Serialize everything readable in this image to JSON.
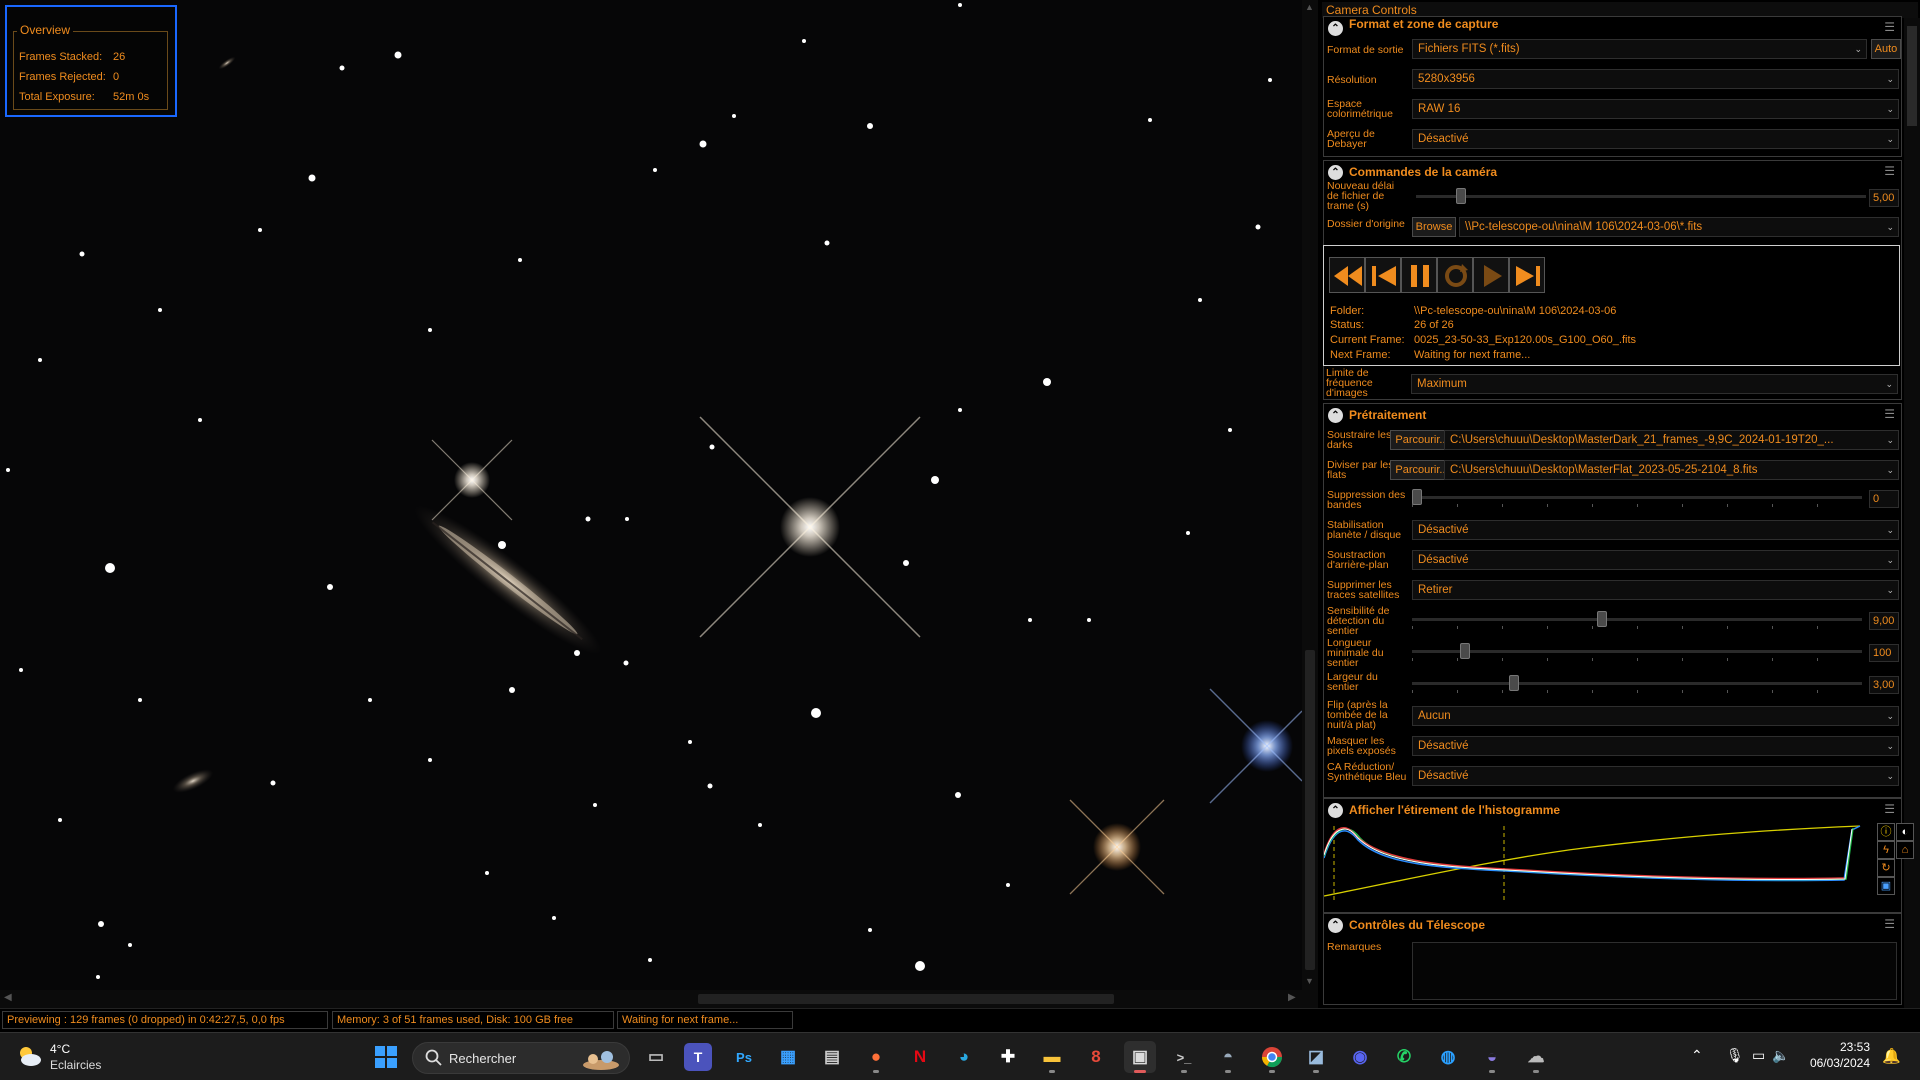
{
  "overview": {
    "legend": "Overview",
    "rows": [
      {
        "label": "Frames Stacked:",
        "value": "26"
      },
      {
        "label": "Frames Rejected:",
        "value": "0"
      },
      {
        "label": "Total Exposure:",
        "value": "52m 0s"
      }
    ]
  },
  "panel": {
    "title": "Camera Controls",
    "format": {
      "heading": "Format et zone de capture",
      "output_label": "Format de sortie",
      "output_value": "Fichiers FITS (*.fits)",
      "auto_button": "Auto",
      "resolution_label": "Résolution",
      "resolution_value": "5280x3956",
      "colorspace_label": "Espace colorimétrique",
      "colorspace_value": "RAW 16",
      "debayer_label": "Aperçu de Debayer",
      "debayer_value": "Désactivé"
    },
    "camera": {
      "heading": "Commandes de la caméra",
      "delay_label": "Nouveau délai de fichier de trame (s)",
      "delay_value": "5,00",
      "delay_level": 0.09,
      "source_label": "Dossier d'origine",
      "browse_button": "Browse",
      "source_value": "\\\\Pc-telescope-ou\\nina\\M 106\\2024-03-06\\*.fits",
      "player_buttons": [
        "rewind-icon",
        "skip-start-icon",
        "pause-icon",
        "refresh-icon",
        "play-icon",
        "skip-end-icon"
      ],
      "info": [
        {
          "label": "Folder:",
          "value": "\\\\Pc-telescope-ou\\nina\\M 106\\2024-03-06"
        },
        {
          "label": "Status:",
          "value": "26 of 26"
        },
        {
          "label": "Current Frame:",
          "value": "0025_23-50-33_Exp120.00s_G100_O60_.fits"
        },
        {
          "label": "Next Frame:",
          "value": "Waiting for next frame..."
        }
      ],
      "framerate_label": "Limite de fréquence d'images",
      "framerate_value": "Maximum"
    },
    "preprocessing": {
      "heading": "Prétraitement",
      "darks_label": "Soustraire les darks",
      "darks_button": "Parcourir...",
      "darks_value": "C:\\Users\\chuuu\\Desktop\\MasterDark_21_frames_-9,9C_2024-01-19T20_...",
      "flats_label": "Diviser par les flats",
      "flats_button": "Parcourir...",
      "flats_value": "C:\\Users\\chuuu\\Desktop\\MasterFlat_2023-05-25-2104_8.fits",
      "banding_label": "Suppression des bandes",
      "banding_value": "0",
      "banding_level": 0.0,
      "stabilization_label": "Stabilisation planète / disque",
      "stabilization_value": "Désactivé",
      "background_label": "Soustraction d'arrière-plan",
      "background_value": "Désactivé",
      "satellite_label": "Supprimer les traces satellites",
      "satellite_value": "Retirer",
      "sensitivity_label": "Sensibilité de détection du sentier",
      "sensitivity_value": "9,00",
      "sensitivity_level": 0.42,
      "minlength_label": "Longueur minimale du sentier",
      "minlength_value": "100",
      "minlength_level": 0.11,
      "width_label": "Largeur du sentier",
      "width_value": "3,00",
      "width_level": 0.22,
      "flip_label": "Flip (après la tombée de la nuit/à plat)",
      "flip_value": "Aucun",
      "mask_label": "Masquer les pixels exposés",
      "mask_value": "Désactivé",
      "ca_label": "CA Réduction/ Synthétique Bleu",
      "ca_value": "Désactivé"
    },
    "histogram": {
      "heading": "Afficher l'étirement de l'histogramme",
      "icons": [
        "info-icon",
        "contrast-icon",
        "lightning-icon",
        "lock-icon",
        "reset-icon",
        "save-icon"
      ]
    },
    "telescope": {
      "heading": "Contrôles du Télescope",
      "notes_label": "Remarques",
      "notes_value": ""
    }
  },
  "statusbar": {
    "preview": "Previewing : 129 frames (0 dropped) in 0:42:27,5, 0,0 fps",
    "memory": "Memory: 3 of 51 frames used, Disk: 100 GB free",
    "state": "Waiting for next frame..."
  },
  "taskbar": {
    "weather_temp": "4°C",
    "weather_desc": "Eclaircies",
    "search_placeholder": "Rechercher",
    "apps": [
      "task-view-icon",
      "teams-icon",
      "photoshop-icon",
      "store-icon",
      "calculator-icon",
      "firefox-icon",
      "netflix-icon",
      "edge-icon",
      "plus-app-icon",
      "file-explorer-icon",
      "app-8-icon",
      "sharpcap-icon",
      "terminal-icon",
      "astro-app-icon",
      "chrome-icon",
      "telescope-app-icon",
      "discord-icon",
      "whatsapp-icon",
      "messenger-icon",
      "stellarium-icon",
      "weather-app-icon"
    ],
    "time": "23:53",
    "date": "06/03/2024"
  },
  "colors": {
    "accent": "#f08c1e",
    "overview_border": "#1a68ff",
    "background": "#000000"
  }
}
